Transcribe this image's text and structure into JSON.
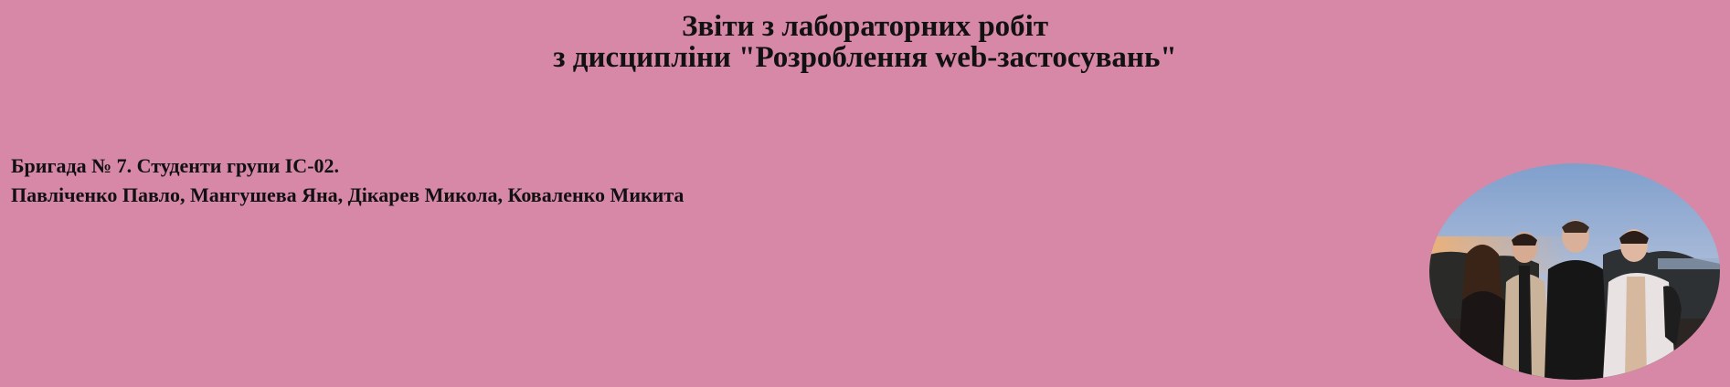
{
  "header": {
    "line1": "Звіти з лабораторних робіт",
    "line2": "з дисципліни \"Розроблення web-застосувань\""
  },
  "team": {
    "line1": "Бригада № 7. Студенти групи ІС-02.",
    "line2": "Павліченко Павло, Мангушева Яна, Дікарев Микола, Коваленко Микита"
  },
  "colors": {
    "background": "#d788a7",
    "text": "#111111"
  }
}
